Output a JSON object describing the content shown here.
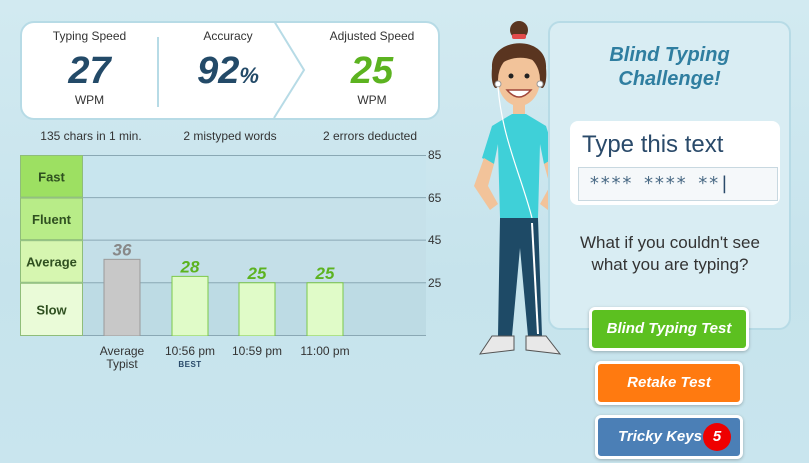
{
  "stats": {
    "typing_speed": {
      "label": "Typing Speed",
      "value": "27",
      "unit": "WPM",
      "note": "135 chars in 1 min."
    },
    "accuracy": {
      "label": "Accuracy",
      "value": "92",
      "suffix": "%",
      "note": "2 mistyped words"
    },
    "adjusted_speed": {
      "label": "Adjusted Speed",
      "value": "25",
      "unit": "WPM",
      "note": "2 errors deducted"
    }
  },
  "colors": {
    "accent_green": "#5cc020",
    "accent_blue": "#2f7ea0",
    "dark_blue": "#234a68",
    "orange": "#ff7a10",
    "red_badge": "#e00000"
  },
  "chart_data": {
    "type": "bar",
    "categories": [
      "Average Typist",
      "10:56 pm",
      "10:59 pm",
      "11:00 pm"
    ],
    "values": [
      36,
      28,
      25,
      25
    ],
    "bands": [
      {
        "label": "Fast",
        "from": 65,
        "to": 85
      },
      {
        "label": "Fluent",
        "from": 45,
        "to": 65
      },
      {
        "label": "Average",
        "from": 25,
        "to": 45
      },
      {
        "label": "Slow",
        "from": 0,
        "to": 25
      }
    ],
    "y_ticks": [
      85,
      65,
      45,
      25
    ],
    "ylim": [
      0,
      85
    ],
    "best_marker": {
      "category": "10:56 pm",
      "label": "BEST"
    }
  },
  "card": {
    "title_line1": "Blind Typing",
    "title_line2": "Challenge!",
    "type_heading": "Type this text",
    "masked_text": "**** **** **",
    "question": "What if you couldn't see what you are typing?"
  },
  "buttons": {
    "blind_test": "Blind Typing Test",
    "retake": "Retake Test",
    "tricky_keys": "Tricky Keys",
    "tricky_count": "5"
  }
}
